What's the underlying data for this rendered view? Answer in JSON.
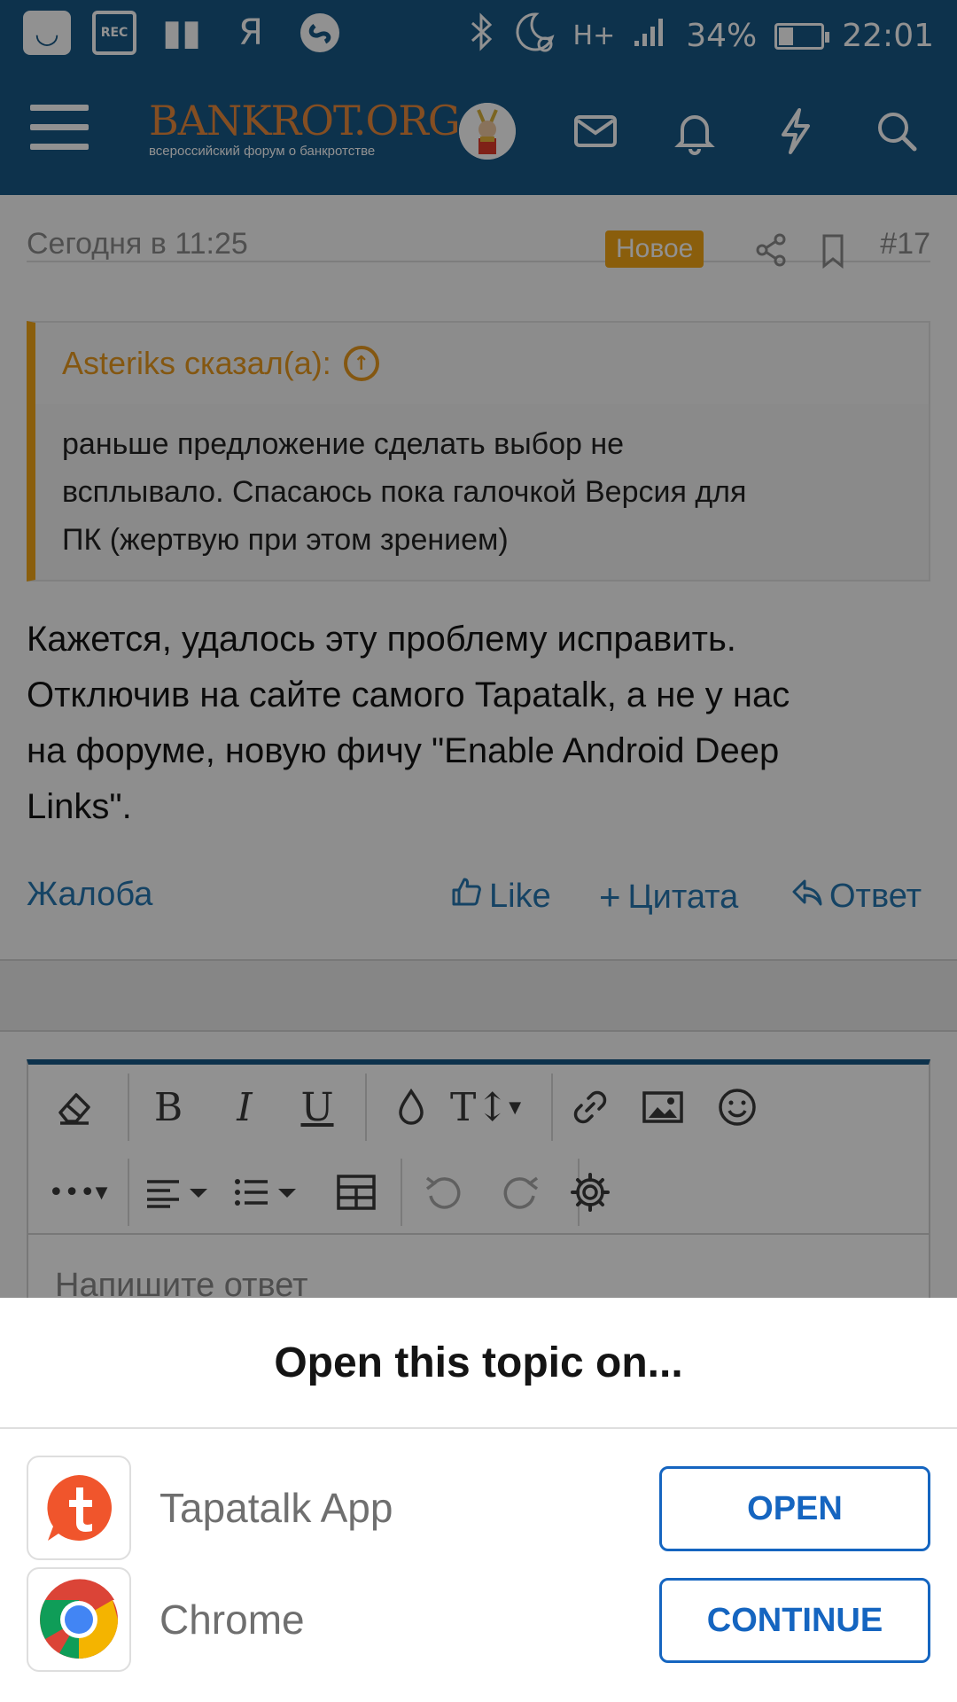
{
  "status_bar": {
    "rec_label": "REC",
    "ya_label": "Я",
    "network": "H+",
    "battery_percent": "34%",
    "battery_level": 0.34,
    "time": "22:01"
  },
  "app_bar": {
    "logo_text": "BANKROT.ORG",
    "logo_subtitle": "всероссийский форум о банкротстве"
  },
  "post": {
    "date": "Сегодня в 11:25",
    "badge": "Новое",
    "number": "#17",
    "quote_author": "Asteriks сказал(а):",
    "quote_lines": [
      "раньше предложение сделать выбор не",
      "всплывало. Спасаюсь пока галочкой Версия для",
      "ПК (жертвую при этом зрением)"
    ],
    "text_lines": [
      "Кажется, удалось эту проблему исправить.",
      "Отключив на сайте самого Tapatalk, а не у нас",
      "на форуме, новую фичу \"Enable Android Deep",
      "Links\"."
    ],
    "actions": {
      "report": "Жалоба",
      "like": "Like",
      "quote": "Цитата",
      "reply": "Ответ"
    }
  },
  "editor": {
    "placeholder": "Напишите ответ"
  },
  "sheet": {
    "title": "Open this topic on...",
    "apps": [
      {
        "name": "Tapatalk App",
        "button": "OPEN",
        "icon": "tapatalk-icon"
      },
      {
        "name": "Chrome",
        "button": "CONTINUE",
        "icon": "chrome-icon"
      }
    ]
  },
  "colors": {
    "primary": "#185887",
    "accent_orange": "#f2a516",
    "link_blue": "#2577b1",
    "button_blue": "#1565c0",
    "overlay": "rgba(0,0,0,0.43)"
  }
}
